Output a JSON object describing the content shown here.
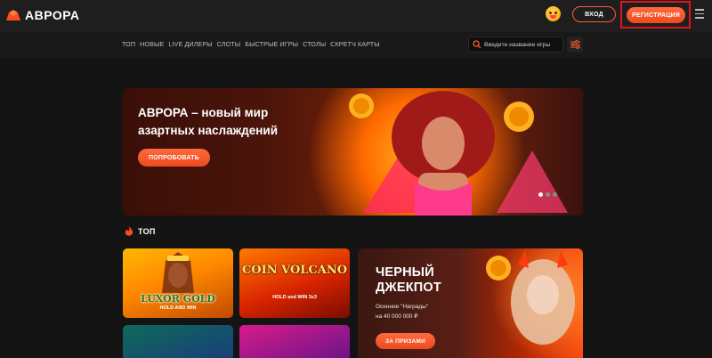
{
  "header": {
    "brand": "АВРОРА",
    "login_label": "ВХОД",
    "register_label": "РЕГИСТРАЦИЯ"
  },
  "nav": {
    "items": [
      "ТОП",
      "НОВЫЕ",
      "LIVE ДИЛЕРЫ",
      "СЛОТЫ",
      "БЫСТРЫЕ ИГРЫ",
      "СТОЛЫ",
      "СКРЕТЧ КАРТЫ"
    ],
    "search_placeholder": "Введите название игры"
  },
  "banner": {
    "title": "АВРОРА – новый мир азартных наслаждений",
    "button_label": "ПОПРОБОВАТЬ",
    "slides": 3,
    "active_slide": 1
  },
  "section": {
    "title": "ТОП"
  },
  "games": [
    {
      "title": "LUXOR GOLD",
      "subtitle": "HOLD AND WIN"
    },
    {
      "title": "COIN VOLCANO",
      "subtitle": "HOLD and WIN 3x3"
    }
  ],
  "jackpot": {
    "title": "ЧЕРНЫЙ ДЖЕКПОТ",
    "subtitle_line1": "Осенние \"Награды\"",
    "subtitle_line2": "на 40 000 000 ₽",
    "button_label": "ЗА ПРИЗАМИ"
  },
  "colors": {
    "accent": "#f04a1e",
    "highlight_border": "#e0141c",
    "background": "#141414"
  }
}
